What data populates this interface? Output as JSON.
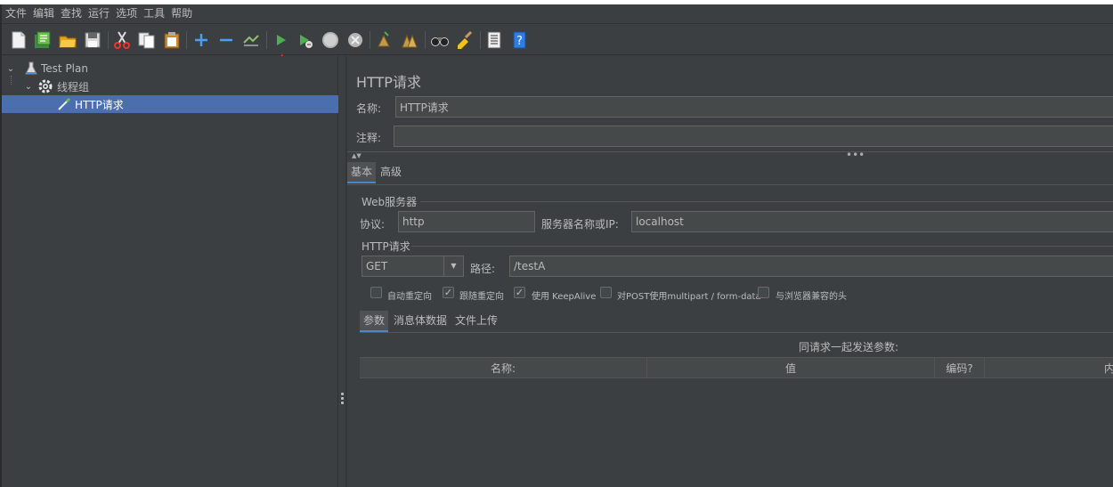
{
  "menu": [
    "文件",
    "编辑",
    "查找",
    "运行",
    "选项",
    "工具",
    "帮助"
  ],
  "toolbar": {
    "icons": [
      "new-icon",
      "templates-icon",
      "open-icon",
      "save-icon",
      "cut-icon",
      "copy-icon",
      "paste-icon",
      "expand-icon",
      "collapse-icon",
      "toggle-icon",
      "start-icon",
      "start-no-pauses-icon",
      "stop-icon",
      "shutdown-icon",
      "clear-icon",
      "clear-all-icon",
      "search-icon",
      "reset-search-icon",
      "function-helper-icon",
      "help-icon"
    ]
  },
  "tree": {
    "items": [
      {
        "label": "Test Plan",
        "icon": "flask-icon"
      },
      {
        "label": "线程组",
        "icon": "gear-icon"
      },
      {
        "label": "HTTP请求",
        "icon": "pipette-icon"
      }
    ]
  },
  "panel": {
    "title": "HTTP请求",
    "name_label": "名称:",
    "name_value": "HTTP请求",
    "comment_label": "注释:",
    "comment_value": "",
    "tabs": [
      "基本",
      "高级"
    ],
    "web_server_section": "Web服务器",
    "protocol_label": "协议:",
    "protocol_value": "http",
    "server_label": "服务器名称或IP:",
    "server_value": "localhost",
    "http_section": "HTTP请求",
    "method_value": "GET",
    "path_label": "路径:",
    "path_value": "/testA",
    "options": [
      {
        "label": "自动重定向",
        "checked": false
      },
      {
        "label": "跟随重定向",
        "checked": true
      },
      {
        "label": "使用 KeepAlive",
        "checked": true
      },
      {
        "label": "对POST使用multipart / form-data",
        "checked": false
      },
      {
        "label": "与浏览器兼容的头",
        "checked": false
      }
    ],
    "param_tabs": [
      "参数",
      "消息体数据",
      "文件上传"
    ],
    "params_caption": "同请求一起发送参数:",
    "columns": [
      "名称:",
      "值",
      "编码?",
      "内"
    ]
  },
  "colors": {
    "background": "#3c3f41",
    "selection": "#4b6eaf",
    "run_green": "#4caf50",
    "arrow_red": "#ff2d2d"
  }
}
